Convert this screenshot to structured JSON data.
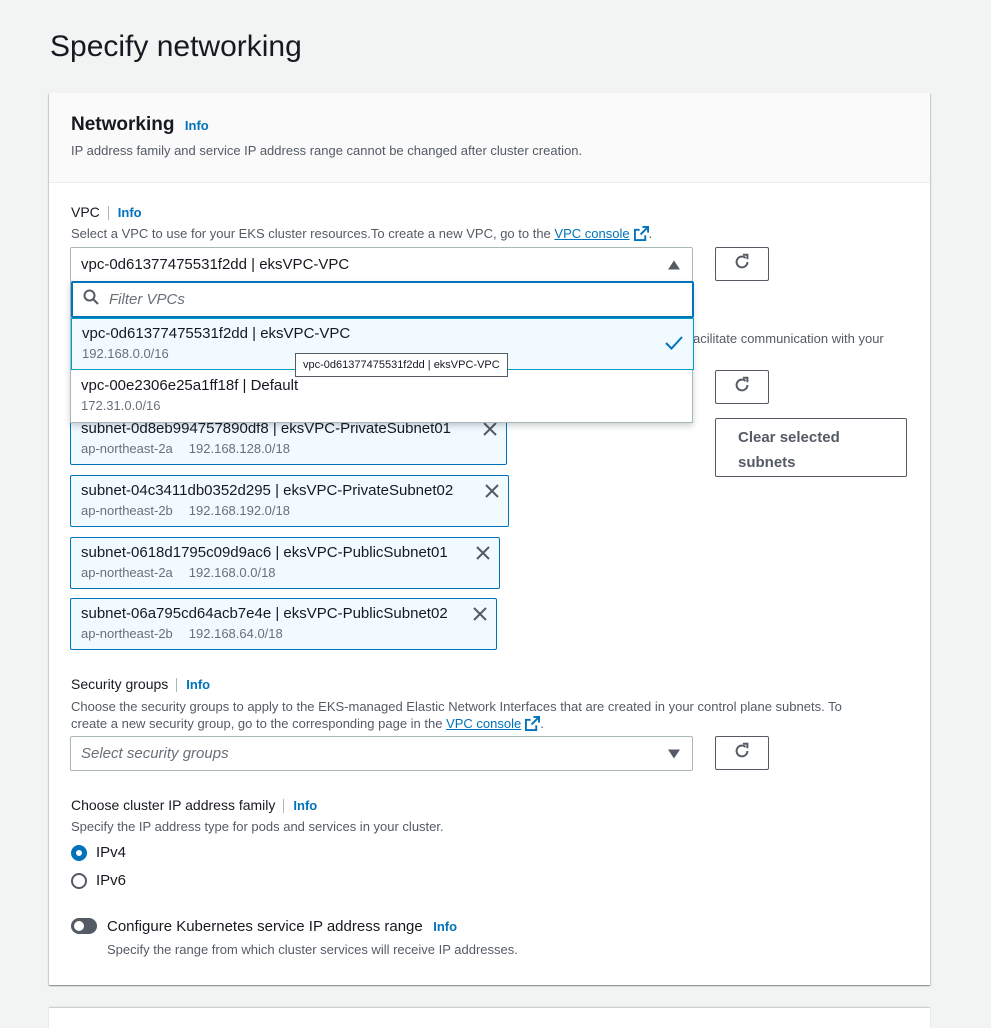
{
  "page": {
    "title": "Specify networking"
  },
  "networking": {
    "title": "Networking",
    "info": "Info",
    "description": "IP address family and service IP address range cannot be changed after cluster creation."
  },
  "vpc": {
    "label": "VPC",
    "info": "Info",
    "description_prefix": "Select a VPC to use for your EKS cluster resources.To create a new VPC, go to the ",
    "console_link": "VPC console",
    "description_suffix": ".",
    "selected": "vpc-0d61377475531f2dd | eksVPC-VPC",
    "filter_placeholder": "Filter VPCs",
    "options": [
      {
        "name": "vpc-0d61377475531f2dd | eksVPC-VPC",
        "cidr": "192.168.0.0/16"
      },
      {
        "name": "vpc-00e2306e25a1ff18f | Default",
        "cidr": "172.31.0.0/16"
      }
    ],
    "tooltip": "vpc-0d61377475531f2dd | eksVPC-VPC"
  },
  "subnets": {
    "partial_description": "acilitate communication with your",
    "clear_label_line1": "Clear selected",
    "clear_label_line2": "subnets",
    "tokens": [
      {
        "name": "subnet-0d8eb994757890df8 | eksVPC-PrivateSubnet01",
        "az": "ap-northeast-2a",
        "cidr": "192.168.128.0/18"
      },
      {
        "name": "subnet-04c3411db0352d295 | eksVPC-PrivateSubnet02",
        "az": "ap-northeast-2b",
        "cidr": "192.168.192.0/18"
      },
      {
        "name": "subnet-0618d1795c09d9ac6 | eksVPC-PublicSubnet01",
        "az": "ap-northeast-2a",
        "cidr": "192.168.0.0/18"
      },
      {
        "name": "subnet-06a795cd64acb7e4e | eksVPC-PublicSubnet02",
        "az": "ap-northeast-2b",
        "cidr": "192.168.64.0/18"
      }
    ]
  },
  "security_groups": {
    "label": "Security groups",
    "info": "Info",
    "description_line1": "Choose the security groups to apply to the EKS-managed Elastic Network Interfaces that are created in your control plane subnets. To",
    "description_line2_prefix": "create a new security group, go to the corresponding page in the ",
    "console_link": "VPC console",
    "description_suffix": ".",
    "placeholder": "Select security groups"
  },
  "ip_family": {
    "label": "Choose cluster IP address family",
    "info": "Info",
    "description": "Specify the IP address type for pods and services in your cluster.",
    "options": [
      "IPv4",
      "IPv6"
    ],
    "selected": "IPv4"
  },
  "service_range": {
    "label": "Configure Kubernetes service IP address range",
    "info": "Info",
    "description": "Specify the range from which cluster services will receive IP addresses."
  },
  "colors": {
    "accent": "#0073bb",
    "text": "#16191f",
    "muted": "#545b64",
    "token_bg": "#f1faff"
  }
}
